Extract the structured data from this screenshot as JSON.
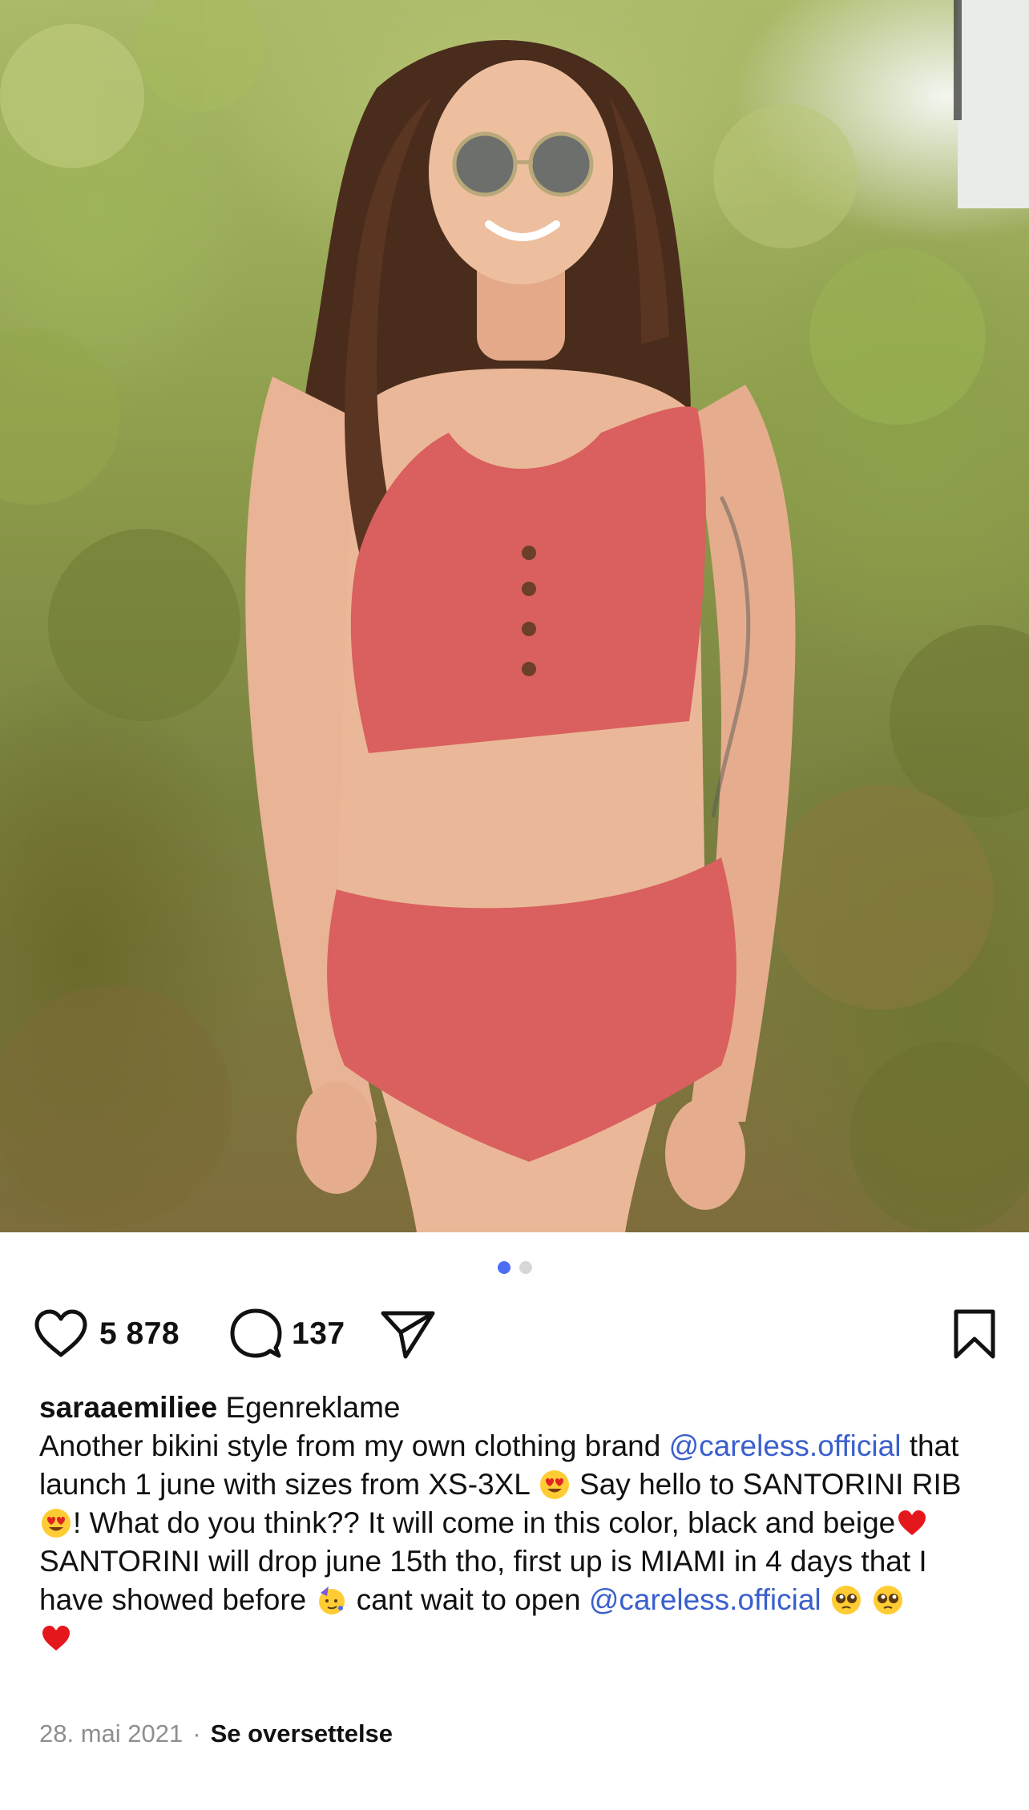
{
  "post": {
    "image_alt": "Woman wearing a coral ribbed bikini outdoors in front of green shrubs",
    "carousel": {
      "count": 2,
      "active_index": 0
    }
  },
  "actions": {
    "likes": "5 878",
    "comments": "137"
  },
  "caption": {
    "username": "saraaemiliee",
    "tag": "Egenreklame",
    "t1": " Another bikini style from my own clothing brand ",
    "mention1": "@careless.official",
    "t2": " that launch 1 june with sizes from XS-3XL ",
    "t3": " Say hello to SANTORINI RIB ",
    "t4": "! What do you think?? It will come in this color, black and beige",
    "t5": " SANTORINI will drop june 15th tho, first up is MIAMI in 4 days that I have showed before ",
    "t6": " cant wait to open ",
    "mention2": "@careless.official"
  },
  "meta": {
    "date": "28. mai 2021",
    "separator": "·",
    "translate": "Se oversettelse"
  },
  "colors": {
    "accent_dot": "#4c6ef5",
    "mention": "#3a5fcd",
    "bikini": "#d9605e"
  },
  "icons": [
    "heart-icon",
    "comment-icon",
    "share-icon",
    "bookmark-icon",
    "heart-eyes-emoji",
    "red-heart-emoji",
    "party-face-emoji",
    "pleading-face-emoji"
  ]
}
